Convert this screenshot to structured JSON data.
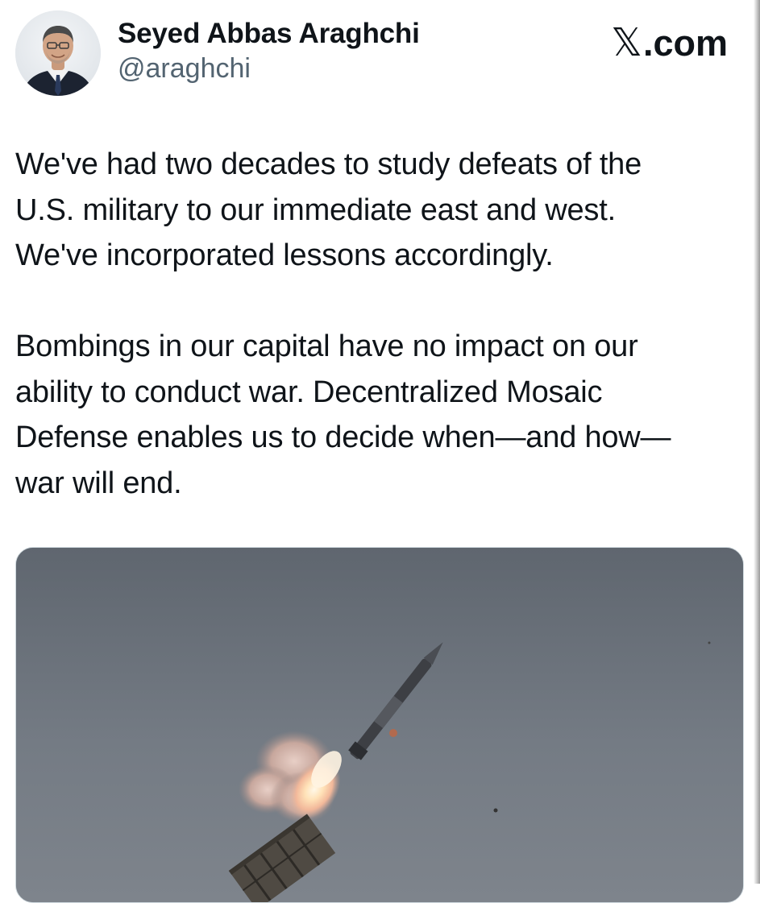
{
  "tweet": {
    "author": {
      "display_name": "Seyed Abbas Araghchi",
      "handle": "@araghchi",
      "avatar_icon": "profile-photo"
    },
    "brand": {
      "label": ".com",
      "icon": "x-logo-icon",
      "icon_glyph": "𝕏"
    },
    "paragraphs": [
      {
        "lines": [
          "We've had two decades to study defeats of the",
          "U.S. military to our immediate east and west.",
          "We've incorporated lessons accordingly."
        ]
      },
      {
        "lines": [
          "Bombings in our capital have no impact on our",
          "ability to conduct war. Decentralized Mosaic",
          "Defense enables us to decide when—and how—",
          "war will end."
        ]
      }
    ],
    "media": {
      "kind": "photo",
      "subject": "missile-launch"
    }
  },
  "colors": {
    "text_primary": "#0f1419",
    "text_secondary": "#536471",
    "background": "#ffffff",
    "sky": "#6f7680"
  }
}
